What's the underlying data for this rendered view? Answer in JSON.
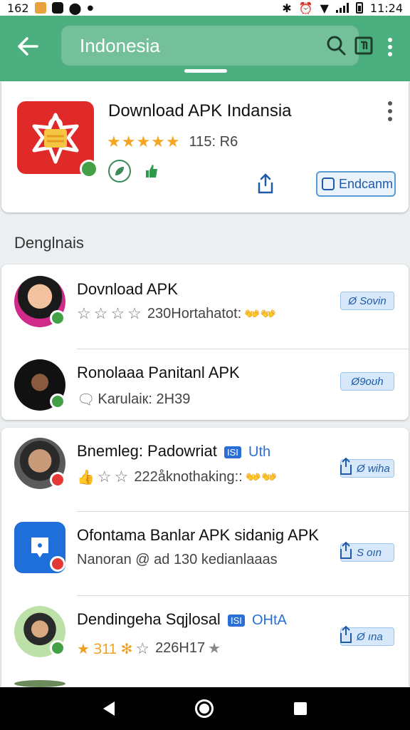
{
  "status_bar": {
    "left_text": "162",
    "time": "11:24"
  },
  "app_bar": {
    "search_value": "Indonesia",
    "colors": {
      "primary": "#4caf7f"
    }
  },
  "featured": {
    "title": "Download APK Indansia",
    "rating_stars": "★★★★★",
    "rating_count": "115: R6",
    "install_label": "Endcanm"
  },
  "section": {
    "title": "Denglnais"
  },
  "list": [
    {
      "title": "Dovnload APK",
      "stars": "☆☆☆☆",
      "sub": "230Hortahatot:",
      "hands": "👐👐",
      "button": "Ø Sovin"
    },
    {
      "title": "Ronolaaa Panitanl APK",
      "sub_prefix": "Karulaiк: 2H39",
      "button": "Ø9oʊh"
    },
    {
      "title": "Bnemleg: Padowriat",
      "tag_chip": "ISI",
      "tag_text": "Uth",
      "stars": "☆☆",
      "sub": "222åknothaking::",
      "hands": "👐👐",
      "button": "Ø wiha"
    },
    {
      "title": "Ofontama Banlar APK sidanig APK",
      "sub": "Nanoran @ ad 130 kedianlaaas",
      "button": "S oın"
    },
    {
      "title": "Dendingeha Sqjlosal",
      "tag_chip": "ISI",
      "tag_text": "OHtA",
      "stars_prefix": "★ Ɜ11 ✻",
      "stars": "☆",
      "sub": "226H17",
      "stars_suffix": "★",
      "button": "Ø ına"
    }
  ]
}
